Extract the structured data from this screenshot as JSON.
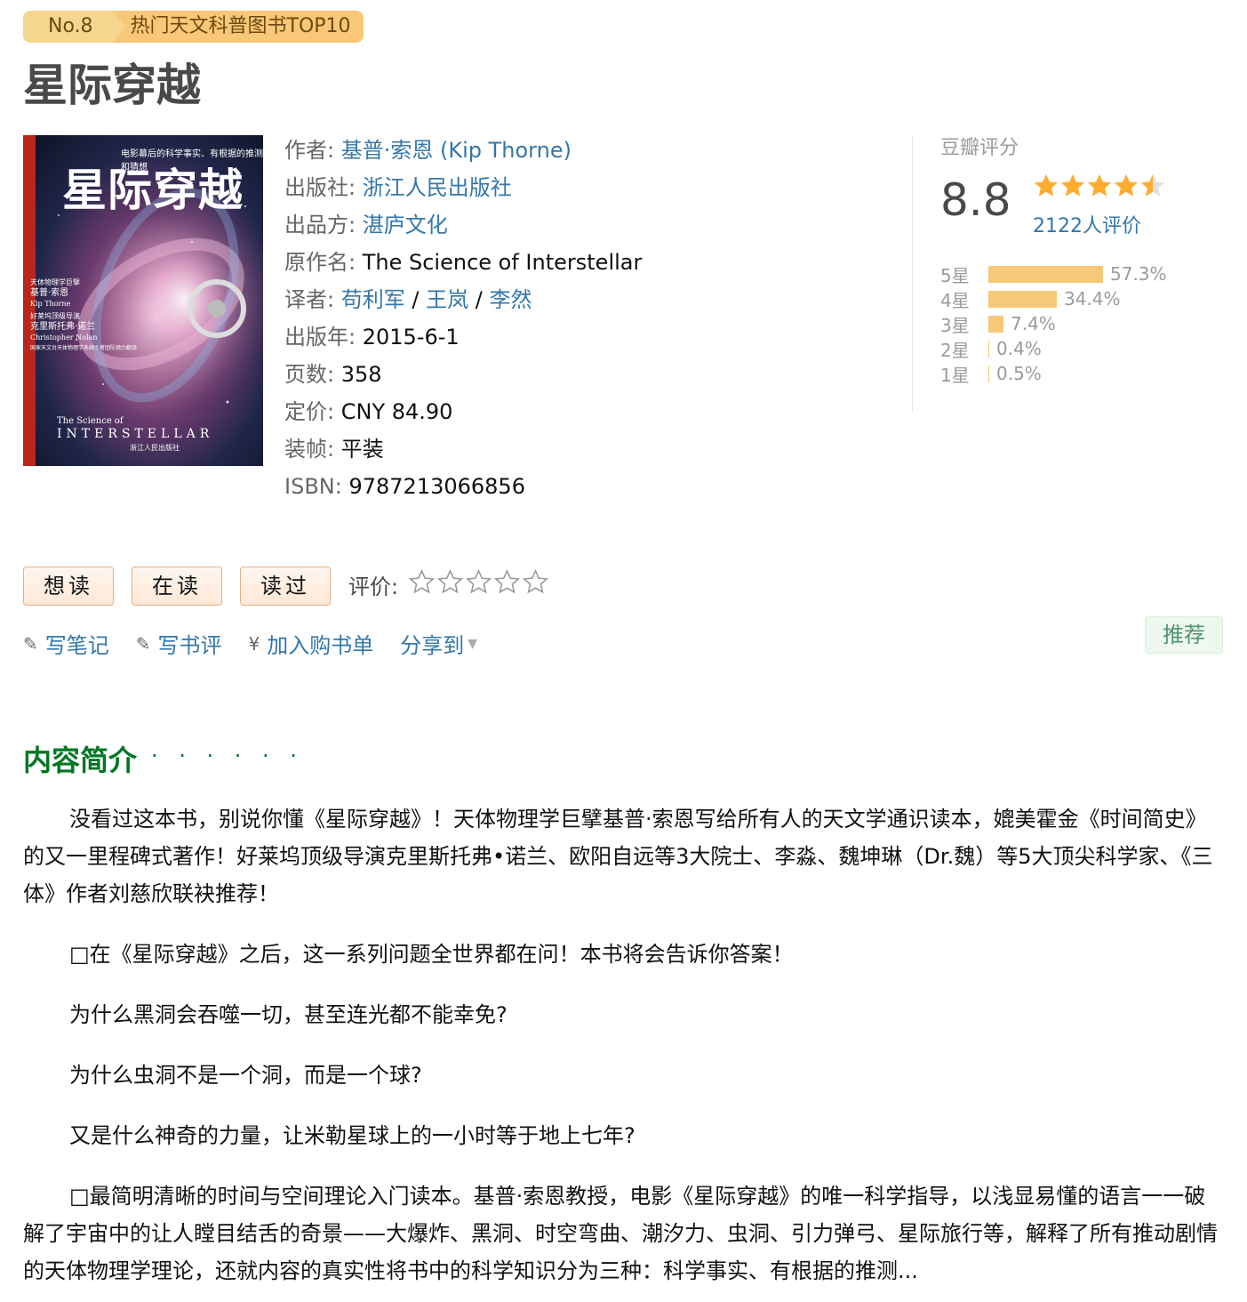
{
  "badge": {
    "no": "No.8",
    "text": "热门天文科普图书TOP10"
  },
  "title": "星际穿越",
  "cover": {
    "title": "星际穿越",
    "subtitle": "电影幕后的科学事实、有根据的推测和猜想",
    "en_small": "The Science of",
    "en_big": "INTERSTELLAR",
    "side_lines": [
      "天体物理学巨擘",
      "基普·索恩",
      "Kip Thorne",
      "好莱坞顶级导演",
      "克里斯托弗·诺兰",
      "Christopher Nolan",
      "国家天文台天体物理学系硕士者团队倾力翻译"
    ],
    "publisher_mark": "浙江人民出版社"
  },
  "info": {
    "author_label": "作者:",
    "author": "基普·索恩 (Kip Thorne)",
    "publisher_label": "出版社:",
    "publisher": "浙江人民出版社",
    "producer_label": "出品方:",
    "producer": "湛庐文化",
    "original_label": "原作名:",
    "original": "The Science of Interstellar",
    "translator_label": "译者:",
    "translators": [
      "苟利军",
      "王岚",
      "李然"
    ],
    "sep": "/",
    "year_label": "出版年:",
    "year": "2015-6-1",
    "pages_label": "页数:",
    "pages": "358",
    "price_label": "定价:",
    "price": "CNY 84.90",
    "binding_label": "装帧:",
    "binding": "平装",
    "isbn_label": "ISBN:",
    "isbn": "9787213066856"
  },
  "rating": {
    "label": "豆瓣评分",
    "score": "8.8",
    "stars": 4.5,
    "count": "2122人评价",
    "distribution": [
      {
        "label": "5星",
        "pct": "57.3%",
        "value": 57.3
      },
      {
        "label": "4星",
        "pct": "34.4%",
        "value": 34.4
      },
      {
        "label": "3星",
        "pct": "7.4%",
        "value": 7.4
      },
      {
        "label": "2星",
        "pct": "0.4%",
        "value": 0.4
      },
      {
        "label": "1星",
        "pct": "0.5%",
        "value": 0.5
      }
    ],
    "star_color": "#ffac2d"
  },
  "actions": {
    "want": "想读",
    "reading": "在读",
    "read": "读过",
    "rate_label": "评价:"
  },
  "tools": {
    "note": "写笔记",
    "review": "写书评",
    "cart": "加入购书单",
    "share": "分享到",
    "recommend": "推荐"
  },
  "summary": {
    "title": "内容简介",
    "dots": "· · · · · ·",
    "paragraphs": [
      "没看过这本书，别说你懂《星际穿越》！天体物理学巨擘基普·索恩写给所有人的天文学通识读本，媲美霍金《时间简史》的又一里程碑式著作！好莱坞顶级导演克里斯托弗•诺兰、欧阳自远等3大院士、李淼、魏坤琳（Dr.魏）等5大顶尖科学家、《三体》作者刘慈欣联袂推荐！",
      "□在《星际穿越》之后，这一系列问题全世界都在问！本书将会告诉你答案！",
      "为什么黑洞会吞噬一切，甚至连光都不能幸免?",
      "为什么虫洞不是一个洞，而是一个球?",
      "又是什么神奇的力量，让米勒星球上的一小时等于地上七年?",
      "□最简明清晰的时间与空间理论入门读本。基普·索恩教授，电影《星际穿越》的唯一科学指导，以浅显易懂的语言一一破解了宇宙中的让人瞠目结舌的奇景——大爆炸、黑洞、时空弯曲、潮汐力、虫洞、引力弹弓、星际旅行等，解释了所有推动剧情的天体物理学理论，还就内容的真实性将书中的科学知识分为三种：科学事实、有根据的推测..."
    ]
  }
}
